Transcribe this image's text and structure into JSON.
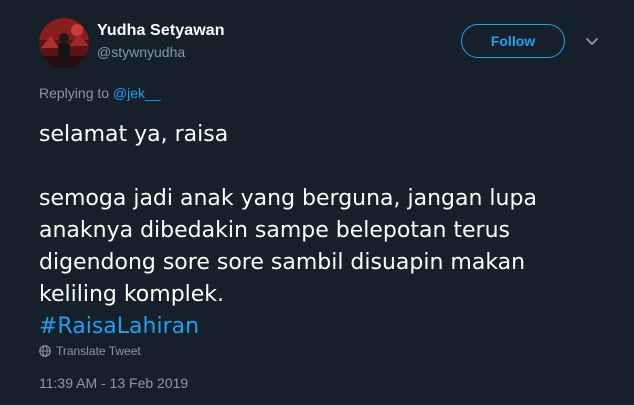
{
  "author": {
    "display_name": "Yudha Setyawan",
    "handle": "@stywnyudha"
  },
  "follow_button": {
    "label": "Follow"
  },
  "reply": {
    "prefix": "Replying to ",
    "mention": "@jek__"
  },
  "tweet": {
    "line1": "selamat ya, raisa",
    "line2": "semoga jadi anak yang berguna, jangan lupa anaknya dibedakin sampe belepotan terus digendong sore sore sambil disuapin makan keliling komplek.",
    "hashtag": "#RaisaLahiran"
  },
  "translate": {
    "label": "Translate Tweet",
    "icon": "globe-icon"
  },
  "timestamp": "11:39 AM - 13 Feb 2019",
  "colors": {
    "background": "#15202b",
    "accent": "#1da1f2",
    "secondary_text": "#8899a6",
    "primary_text": "#ffffff"
  }
}
